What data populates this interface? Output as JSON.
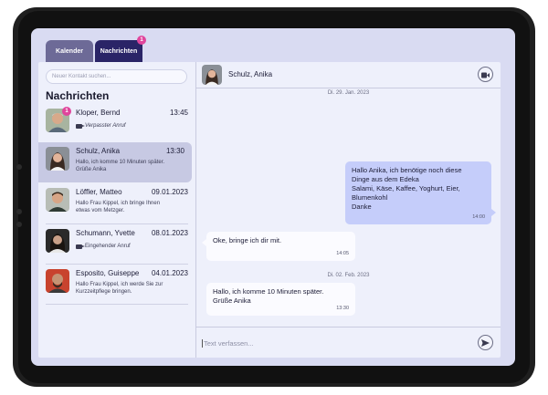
{
  "tabs": [
    {
      "label": "Kalender"
    },
    {
      "label": "Nachrichten",
      "badge": "1"
    }
  ],
  "sidebar": {
    "search_placeholder": "Neuer Kontakt suchen...",
    "title": "Nachrichten",
    "conversations": [
      {
        "name": "Kloper, Bernd",
        "date": "13:45",
        "preview": "Verpasster Anruf",
        "unread": "1",
        "avatar": "bernd-avatar"
      },
      {
        "name": "Schulz, Anika",
        "date": "13:30",
        "preview": "Hallo, ich komme 10 Minuten später. Grüße Anika",
        "avatar": "anika-avatar"
      },
      {
        "name": "Löffler, Matteo",
        "date": "09.01.2023",
        "preview": "Hallo Frau Kippel, ich bringe Ihnen etwas vom Metzger.",
        "avatar": "matteo-avatar"
      },
      {
        "name": "Schumann, Yvette",
        "date": "08.01.2023",
        "preview": "Eingehender Anruf",
        "avatar": "yvette-avatar"
      },
      {
        "name": "Esposito, Guiseppe",
        "date": "04.01.2023",
        "preview": "Hallo Frau Kippel, ich werde Sie zur Kurzzeitpflege bringen.",
        "avatar": "guiseppe-avatar"
      }
    ]
  },
  "chat": {
    "contact_name": "Schulz, Anika",
    "date1": "Di. 29. Jan. 2023",
    "date2": "Di. 02. Feb. 2023",
    "messages": [
      {
        "direction": "out",
        "lines": [
          "Hallo Anika, ich benötige noch diese",
          "Dinge aus dem Edeka",
          "Salami, Käse, Kaffee, Yoghurt, Eier,",
          "Blumenkohl",
          "Danke"
        ],
        "time": "14:00"
      },
      {
        "direction": "in",
        "lines": [
          "Oke, bringe ich dir mit."
        ],
        "time": "14:05"
      },
      {
        "direction": "in",
        "lines": [
          "Hallo, ich komme 10 Minuten später.",
          "Grüße Anika"
        ],
        "time": "13:30"
      }
    ],
    "composer_placeholder": "Text verfassen..."
  },
  "colors": {
    "accent_dark": "#2a2467",
    "badge": "#e0459c",
    "outgoing_bubble": "#c5cdfa",
    "incoming_bubble": "#fbfbff"
  }
}
